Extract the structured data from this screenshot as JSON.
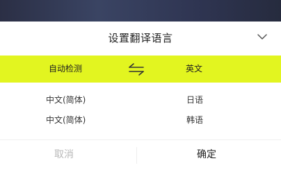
{
  "dialog": {
    "title": "设置翻译语言",
    "source_language": "自动检测",
    "target_language": "英文",
    "accent_color": "#e2f520"
  },
  "source_options": [
    "中文(简体)",
    "中文(简体)"
  ],
  "target_options": [
    "日语",
    "韩语"
  ],
  "footer": {
    "cancel_label": "取消",
    "confirm_label": "确定"
  },
  "icons": {
    "collapse": "chevron-down-icon",
    "swap": "swap-arrows-icon"
  }
}
